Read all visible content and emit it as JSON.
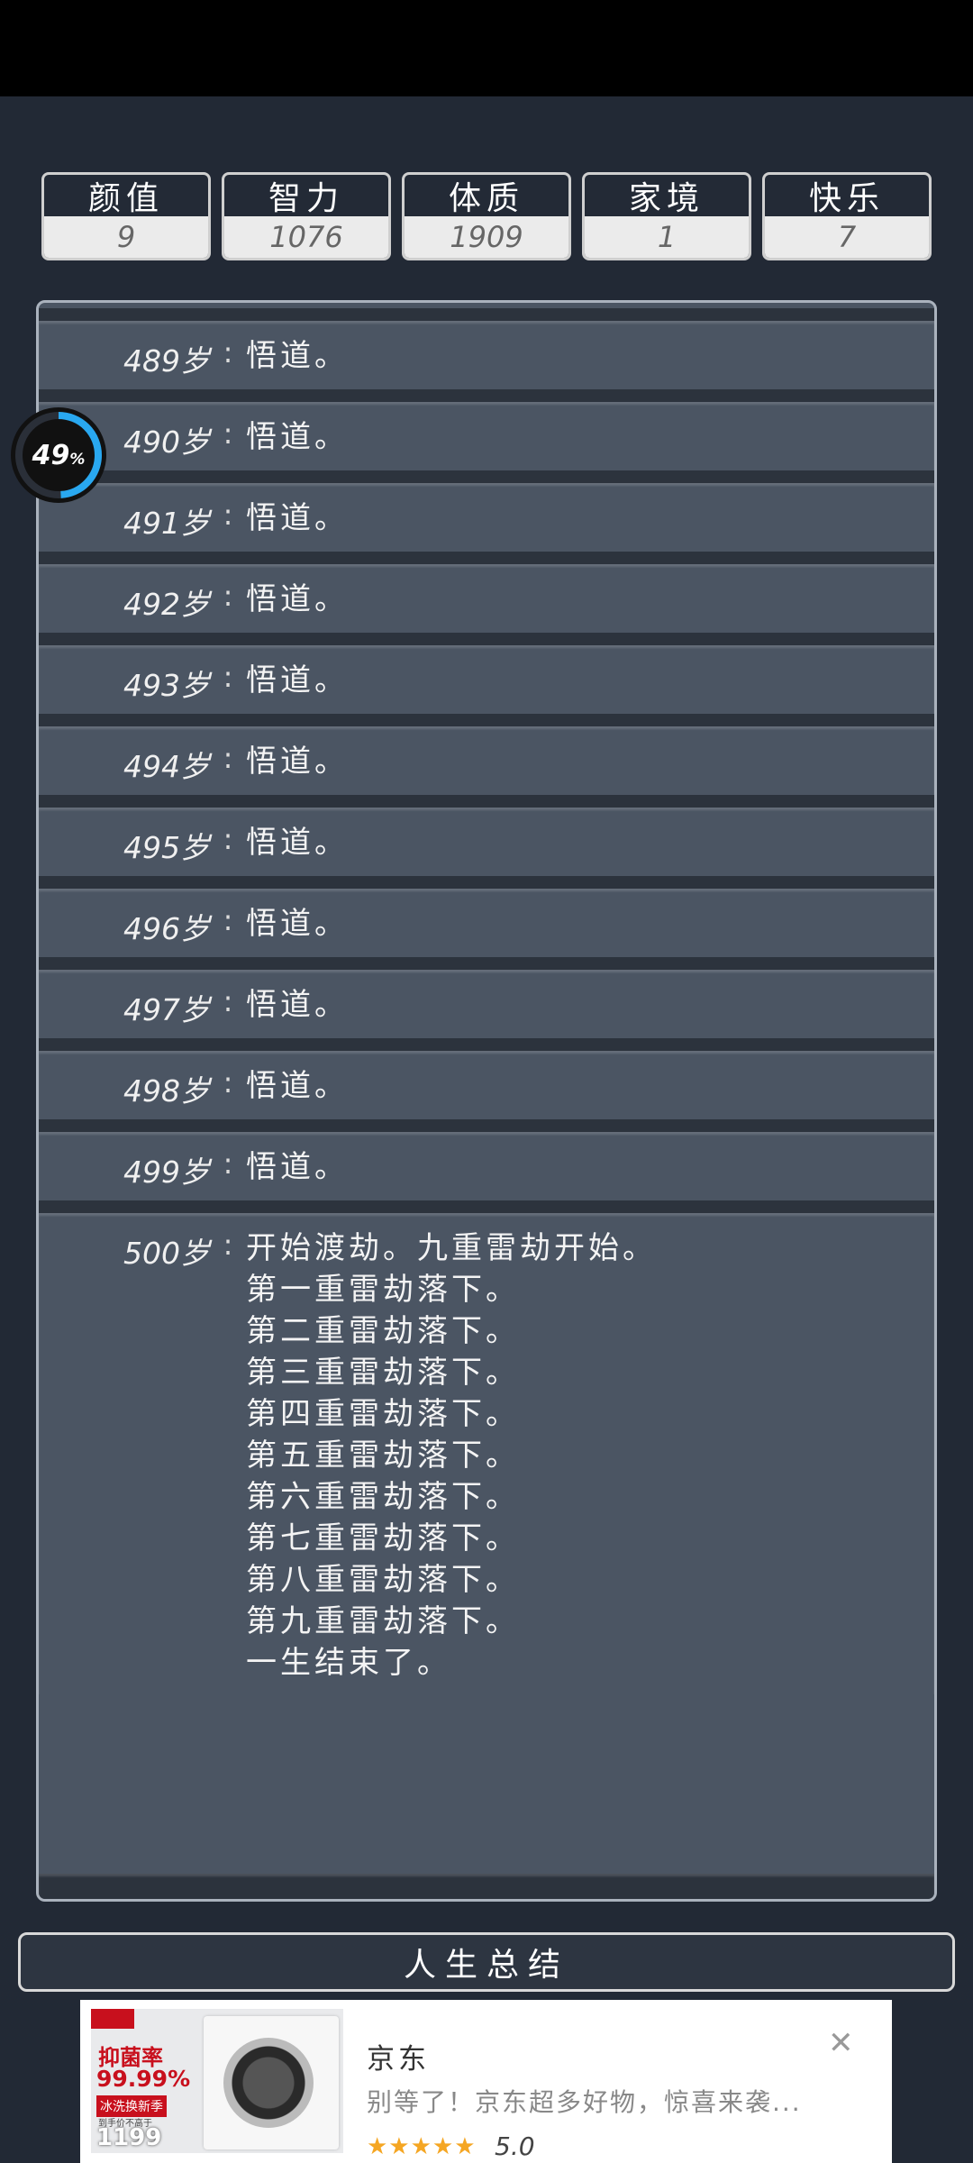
{
  "stats": [
    {
      "label": "颜值",
      "value": "9"
    },
    {
      "label": "智力",
      "value": "1076"
    },
    {
      "label": "体质",
      "value": "1909"
    },
    {
      "label": "家境",
      "value": "1"
    },
    {
      "label": "快乐",
      "value": "7"
    }
  ],
  "progress": {
    "percent": 49,
    "value_text": "49",
    "unit": "%"
  },
  "timeline": [
    {
      "age": "489岁",
      "lines": [
        "悟道。"
      ]
    },
    {
      "age": "490岁",
      "lines": [
        "悟道。"
      ]
    },
    {
      "age": "491岁",
      "lines": [
        "悟道。"
      ]
    },
    {
      "age": "492岁",
      "lines": [
        "悟道。"
      ]
    },
    {
      "age": "493岁",
      "lines": [
        "悟道。"
      ]
    },
    {
      "age": "494岁",
      "lines": [
        "悟道。"
      ]
    },
    {
      "age": "495岁",
      "lines": [
        "悟道。"
      ]
    },
    {
      "age": "496岁",
      "lines": [
        "悟道。"
      ]
    },
    {
      "age": "497岁",
      "lines": [
        "悟道。"
      ]
    },
    {
      "age": "498岁",
      "lines": [
        "悟道。"
      ]
    },
    {
      "age": "499岁",
      "lines": [
        "悟道。"
      ]
    },
    {
      "age": "500岁",
      "lines": [
        "开始渡劫。九重雷劫开始。",
        "第一重雷劫落下。",
        "第二重雷劫落下。",
        "第三重雷劫落下。",
        "第四重雷劫落下。",
        "第五重雷劫落下。",
        "第六重雷劫落下。",
        "第七重雷劫落下。",
        "第八重雷劫落下。",
        "第九重雷劫落下。",
        "一生结束了。"
      ]
    }
  ],
  "separator": ":",
  "summary_button": "人生总结",
  "ad": {
    "image_promo": [
      "抑菌率",
      "99.99%",
      "冰洗换新季",
      "到手价不高于",
      "1199"
    ],
    "brand": "京东",
    "description": "别等了！京东超多好物，惊喜来袭...",
    "stars": "★★★★★",
    "rating": "5.0",
    "close_icon": "close-icon"
  }
}
